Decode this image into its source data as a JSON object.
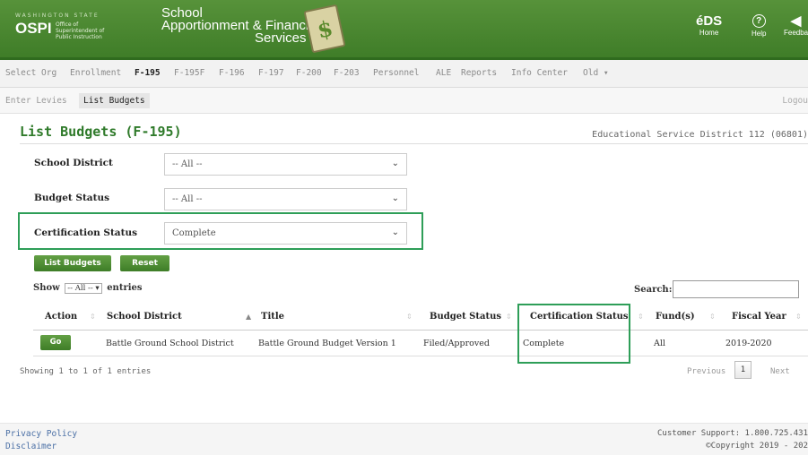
{
  "header": {
    "state_text": "WASHINGTON STATE",
    "logo_text": "OSPI",
    "logo_subtitle": "Office of Superintendent of Public Instruction",
    "app_title_line1": "School",
    "app_title_line2": "Apportionment & Financial",
    "app_title_line3": "Services",
    "buttons": [
      {
        "icon": "eds-icon",
        "glyph": "éDS",
        "label": "Home"
      },
      {
        "icon": "help-icon",
        "glyph": "?",
        "label": "Help"
      },
      {
        "icon": "megaphone-icon",
        "glyph": "◀",
        "label": "Feedba"
      }
    ],
    "colors": {
      "header_green": "#4a8a31",
      "accent_green": "#2f7a2a",
      "highlight": "#2e9e58"
    }
  },
  "tabs": [
    "Select Org",
    "Enrollment",
    "F-195",
    "F-195F",
    "F-196",
    "F-197",
    "F-200",
    "F-203",
    "Personnel",
    "ALE",
    "Reports",
    "Info Center",
    "Old ▾"
  ],
  "active_tab": "F-195",
  "subtabs": [
    "Enter Levies",
    "List Budgets"
  ],
  "active_subtab": "List Budgets",
  "logout": "Logou",
  "page": {
    "title": "List Budgets (F-195)",
    "organization": "Educational Service District 112 (06801)"
  },
  "filters": {
    "school_district": {
      "label": "School District",
      "value": "-- All --"
    },
    "budget_status": {
      "label": "Budget Status",
      "value": "-- All --"
    },
    "certification_status": {
      "label": "Certification Status",
      "value": "Complete"
    }
  },
  "buttons": {
    "list_budgets": "List Budgets",
    "reset": "Reset"
  },
  "table_controls": {
    "show_prefix": "Show",
    "show_value": "-- All --",
    "show_suffix": "entries",
    "search_label": "Search:"
  },
  "table": {
    "columns": [
      "Action",
      "School District",
      "Title",
      "Budget Status",
      "Certification Status",
      "Fund(s)",
      "Fiscal Year"
    ],
    "rows": [
      {
        "action": "Go",
        "district": "Battle Ground School District",
        "title": "Battle Ground Budget Version 1",
        "budget_status": "Filed/Approved",
        "cert_status": "Complete",
        "funds": "All",
        "fiscal_year": "2019-2020"
      }
    ],
    "info": "Showing 1 to 1 of 1 entries",
    "pagination": {
      "previous": "Previous",
      "current": "1",
      "next": "Next"
    }
  },
  "footer": {
    "privacy": "Privacy Policy",
    "disclaimer": "Disclaimer",
    "support": "Customer Support: 1.800.725.431",
    "copyright": "©Copyright 2019 - 202"
  }
}
